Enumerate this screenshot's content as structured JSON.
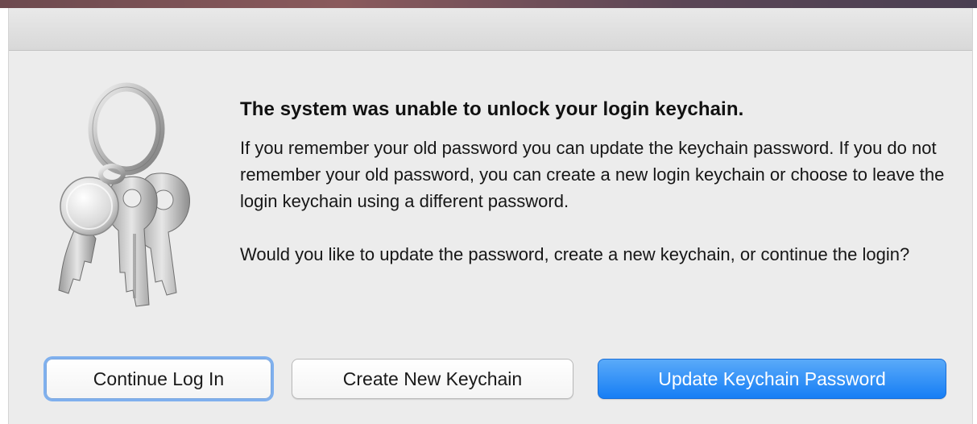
{
  "dialog": {
    "heading": "The system was unable to unlock your login keychain.",
    "paragraph_1": "If you remember your old password you can update the keychain password. If you do not remember your old password, you can create a new login keychain or choose to leave the login keychain using a different password.",
    "paragraph_2": "Would you like to update the password, create a new keychain, or continue the login?",
    "icon": "keychain-keys-icon"
  },
  "buttons": {
    "continue_label": "Continue Log In",
    "create_label": "Create New Keychain",
    "update_label": "Update Keychain Password"
  },
  "colors": {
    "accent": "#167ef5",
    "focus_ring": "#7fb0ee",
    "dialog_background": "#ececec"
  }
}
